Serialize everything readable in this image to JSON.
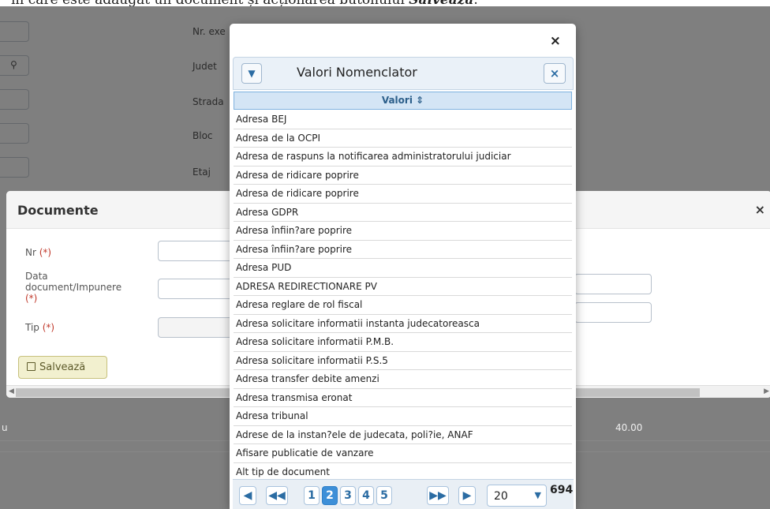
{
  "caption": {
    "prefix": "în care este adăugat un document și acționarea butonului ",
    "emph": "Salvează",
    "suffix": "."
  },
  "background_form": {
    "labels": [
      "Nr. exe",
      "Judet",
      "Strada",
      "Bloc",
      "Etaj"
    ]
  },
  "documents_panel": {
    "title": "Documente",
    "close_icon": "×",
    "fields": {
      "nr_label": "Nr",
      "data_label": "Data document/Impunere",
      "tip_label": "Tip",
      "required_mark": "(*)"
    },
    "save_label": "Salvează",
    "save_icon": "floppy-disk-icon"
  },
  "underlying_table": {
    "row_first_cell": "u",
    "row_amount": "40.00"
  },
  "modal": {
    "close_icon": "×",
    "header_title": "Valori Nomenclator",
    "column_header": "Valori",
    "sort_icon": "⇕",
    "rows": [
      "Adresa BEJ",
      "Adresa de la OCPI",
      "Adresa de raspuns la notificarea administratorului judiciar",
      "Adresa de ridicare poprire",
      "Adresa de ridicare poprire",
      "Adresa GDPR",
      "Adresa înfiin?are poprire",
      "Adresa înfiin?are poprire",
      "Adresa PUD",
      "ADRESA REDIRECTIONARE PV",
      "Adresa reglare de rol fiscal",
      "Adresa solicitare informatii instanta judecatoreasca",
      "Adresa solicitare informatii P.M.B.",
      "Adresa solicitare informatii P.S.5",
      "Adresa transfer debite amenzi",
      "Adresa transmisa eronat",
      "Adresa tribunal",
      "Adrese de la instan?ele de judecata, poli?ie, ANAF",
      "Afisare publicatie de vanzare",
      "Alt tip de document"
    ],
    "pager": {
      "pages": [
        "1",
        "2",
        "3",
        "4",
        "5"
      ],
      "current_page": "2",
      "page_size": "20",
      "total": "694"
    }
  }
}
